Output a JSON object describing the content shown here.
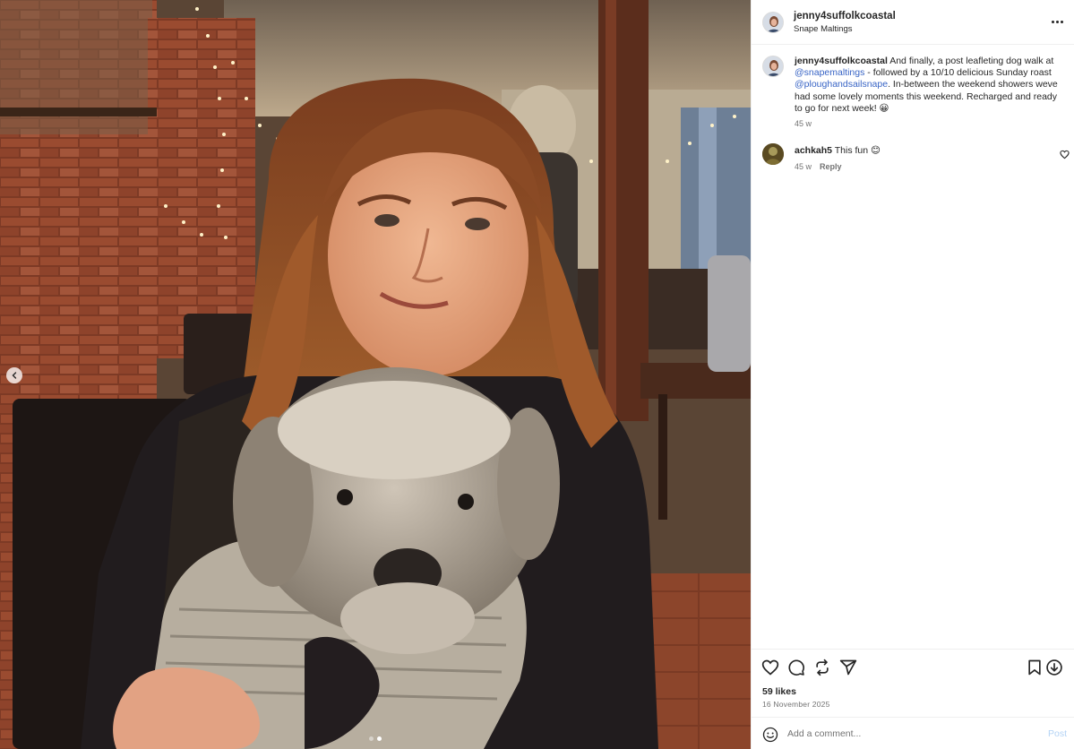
{
  "post": {
    "username": "jenny4suffolkcoastal",
    "location": "Snape Maltings",
    "caption": {
      "intro": "And finally, a post leafleting dog walk at",
      "mention1": "@snapemaltings",
      "middle": "- followed by a 10/10 delicious Sunday roast",
      "mention2": "@ploughandsailsnape",
      "rest": ". In-between the weekend showers weve had some lovely moments this weekend. Recharged and ready to go for next week! 😀"
    },
    "caption_age": "45 w",
    "likes": "59 likes",
    "date": "16 November 2025"
  },
  "comments": [
    {
      "username": "achkah5",
      "text": "This fun 😊",
      "age": "45 w",
      "reply_label": "Reply"
    }
  ],
  "comment_box": {
    "placeholder": "Add a comment...",
    "post_label": "Post"
  },
  "carousel": {
    "total_slides": 2,
    "active_slide": 2
  },
  "icons": {
    "header": [
      "more-options-icon"
    ],
    "actions": [
      "heart-icon",
      "comment-icon",
      "repost-icon",
      "share-icon",
      "bookmark-icon",
      "download-icon"
    ],
    "comment_box": [
      "emoji-icon"
    ],
    "carousel": [
      "chevron-left-icon"
    ]
  },
  "colors": {
    "mention": "#3864c5",
    "post_button_disabled": "#b3d3f5",
    "secondary_text": "#737373",
    "divider": "#efefef"
  }
}
